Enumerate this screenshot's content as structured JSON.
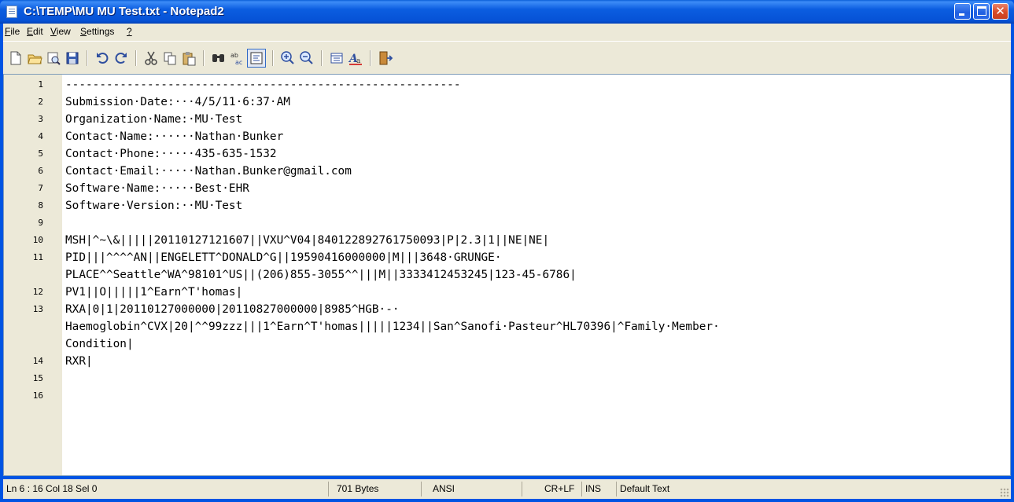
{
  "window": {
    "title": "C:\\TEMP\\MU MU Test.txt - Notepad2"
  },
  "menu": [
    {
      "label": "File",
      "u": "F",
      "rest": "ile"
    },
    {
      "label": "Edit",
      "u": "E",
      "rest": "dit"
    },
    {
      "label": "View",
      "u": "V",
      "rest": "iew"
    },
    {
      "label": "Settings",
      "u": "S",
      "rest": "ettings"
    },
    {
      "label": "?",
      "u": "?",
      "rest": ""
    }
  ],
  "toolbar": {
    "icons": [
      "new-file-icon",
      "open-folder-icon",
      "browse-icon",
      "save-icon",
      "undo-icon",
      "redo-icon",
      "cut-icon",
      "copy-icon",
      "paste-icon",
      "find-icon",
      "replace-icon",
      "word-wrap-icon",
      "zoom-in-icon",
      "zoom-out-icon",
      "scheme-icon",
      "font-icon",
      "exit-icon"
    ]
  },
  "editor": {
    "lines": [
      {
        "n": "1",
        "text": "----------------------------------------------------------"
      },
      {
        "n": "2",
        "text": "Submission·Date:···4/5/11·6:37·AM"
      },
      {
        "n": "3",
        "text": "Organization·Name:·MU·Test"
      },
      {
        "n": "4",
        "text": "Contact·Name:······Nathan·Bunker"
      },
      {
        "n": "5",
        "text": "Contact·Phone:·····435-635-1532"
      },
      {
        "n": "6",
        "text": "Contact·Email:·····Nathan.Bunker@gmail.com"
      },
      {
        "n": "7",
        "text": "Software·Name:·····Best·EHR"
      },
      {
        "n": "8",
        "text": "Software·Version:··MU·Test"
      },
      {
        "n": "9",
        "text": ""
      },
      {
        "n": "10",
        "text": "MSH|^~\\&|||||20110127121607||VXU^V04|840122892761750093|P|2.3|1||NE|NE|"
      },
      {
        "n": "11",
        "text": "PID|||^^^^AN||ENGELETT^DONALD^G||19590416000000|M|||3648·GRUNGE·"
      },
      {
        "n": "",
        "text": "PLACE^^Seattle^WA^98101^US||(206)855-3055^^|||M||3333412453245|123-45-6786|"
      },
      {
        "n": "12",
        "text": "PV1||O|||||1^Earn^T'homas|"
      },
      {
        "n": "13",
        "text": "RXA|0|1|20110127000000|20110827000000|8985^HGB·-·"
      },
      {
        "n": "",
        "text": "Haemoglobin^CVX|20|^^99zzz|||1^Earn^T'homas|||||1234||San^Sanofi·Pasteur^HL70396|^Family·Member·"
      },
      {
        "n": "",
        "text": "Condition|"
      },
      {
        "n": "14",
        "text": "RXR|"
      },
      {
        "n": "15",
        "text": ""
      },
      {
        "n": "16",
        "text": ""
      }
    ]
  },
  "status": {
    "position": "Ln 6 : 16  Col 18  Sel 0",
    "size": "701 Bytes",
    "encoding": "ANSI",
    "eol": "CR+LF",
    "mode": "INS",
    "scheme": "Default Text"
  }
}
